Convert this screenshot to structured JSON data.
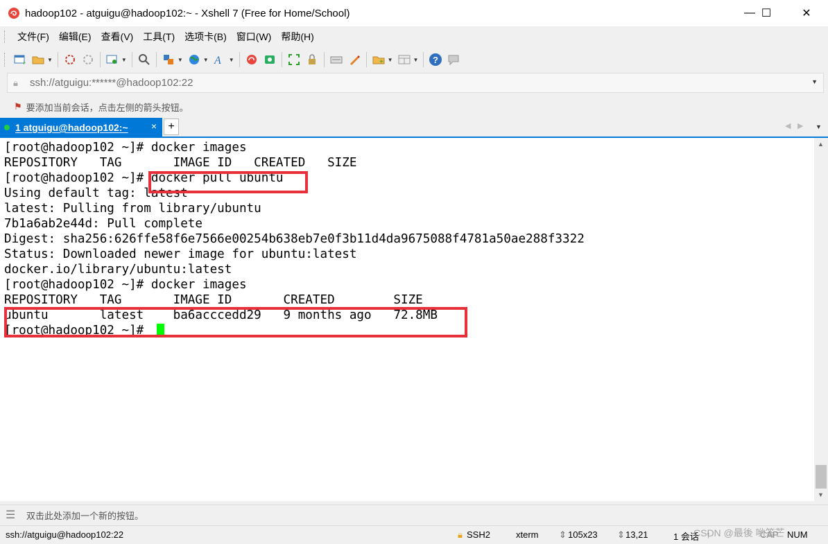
{
  "window": {
    "title": "hadoop102 - atguigu@hadoop102:~ - Xshell 7 (Free for Home/School)",
    "minimize_glyph": "—",
    "maximize_glyph": "☐",
    "close_glyph": "✕"
  },
  "menu": {
    "items": [
      "文件(F)",
      "编辑(E)",
      "查看(V)",
      "工具(T)",
      "选项卡(B)",
      "窗口(W)",
      "帮助(H)"
    ]
  },
  "toolbar": {
    "icons": [
      "new-session-icon",
      "open-folder-icon",
      "connect-icon",
      "disconnect-icon",
      "properties-icon",
      "find-icon",
      "transfer-icon",
      "globe-icon",
      "font-icon",
      "xftp-icon",
      "xmanager-icon",
      "fullscreen-icon",
      "lock-icon",
      "keyboard-icon",
      "script-icon",
      "tab-add-icon",
      "layout-icon",
      "help-icon",
      "chat-icon"
    ]
  },
  "address": {
    "url": "ssh://atguigu:******@hadoop102:22"
  },
  "hint": {
    "text": "要添加当前会话，点击左侧的箭头按钮。"
  },
  "tabs": {
    "active_label": "1 atguigu@hadoop102:~",
    "close_glyph": "×",
    "add_glyph": "+"
  },
  "terminal": {
    "lines": [
      "[root@hadoop102 ~]# docker images",
      "REPOSITORY   TAG       IMAGE ID   CREATED   SIZE",
      "[root@hadoop102 ~]# docker pull ubuntu",
      "Using default tag: latest",
      "latest: Pulling from library/ubuntu",
      "7b1a6ab2e44d: Pull complete",
      "Digest: sha256:626ffe58f6e7566e00254b638eb7e0f3b11d4da9675088f4781a50ae288f3322",
      "Status: Downloaded newer image for ubuntu:latest",
      "docker.io/library/ubuntu:latest",
      "[root@hadoop102 ~]# docker images",
      "REPOSITORY   TAG       IMAGE ID       CREATED        SIZE",
      "ubuntu       latest    ba6acccedd29   9 months ago   72.8MB",
      "[root@hadoop102 ~]# "
    ]
  },
  "compose": {
    "text": "双击此处添加一个新的按钮。"
  },
  "status": {
    "connection": "ssh://atguigu@hadoop102:22",
    "protocol": "SSH2",
    "term": "xterm",
    "size": "105x23",
    "position": "13,21",
    "sessions": "1 会话",
    "caps": "CAP",
    "num": "NUM",
    "watermark": "CSDN @最後 哟答芒"
  },
  "colors": {
    "accent": "#0078d7",
    "highlight_box": "#e8303a",
    "cursor": "#00ff00"
  }
}
